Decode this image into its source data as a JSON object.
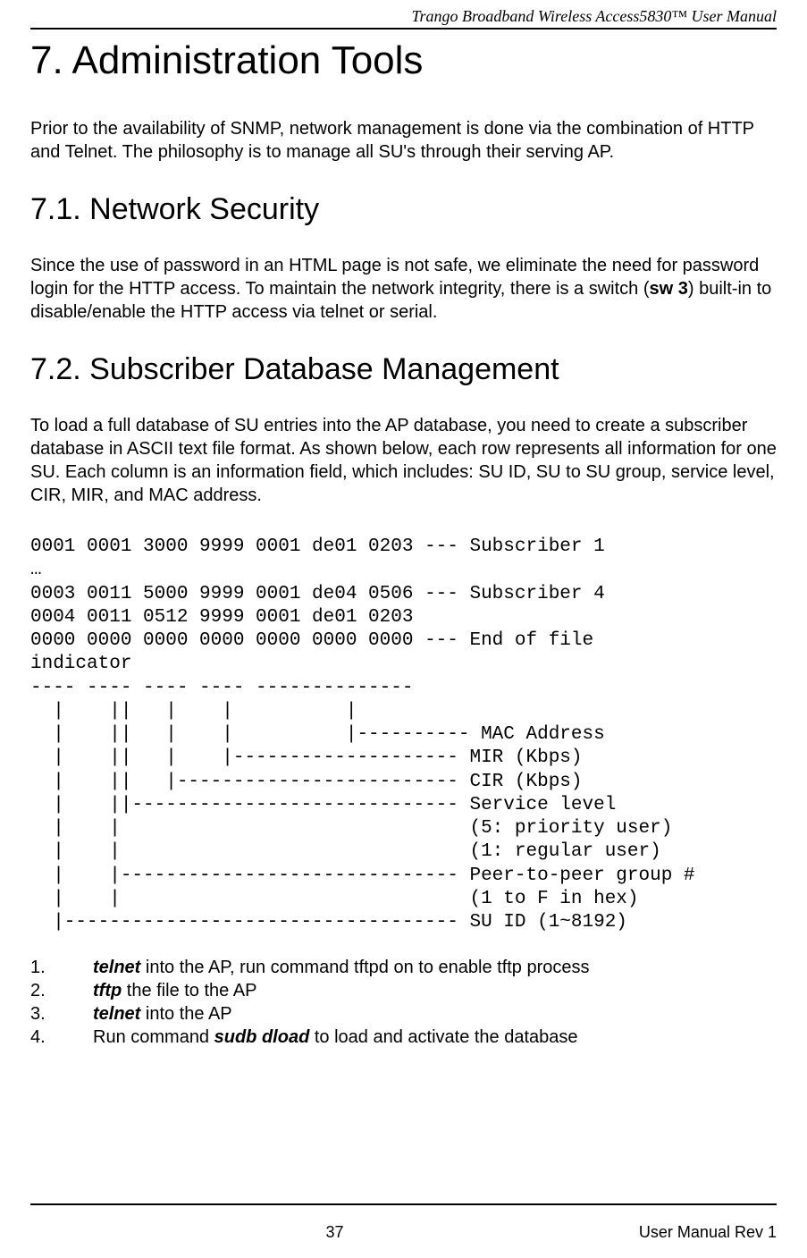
{
  "header": {
    "title": "Trango Broadband Wireless Access5830™  User Manual"
  },
  "h1": "7.  Administration Tools",
  "p1": "Prior to the availability of SNMP, network management is done via the combination of HTTP and Telnet.  The philosophy is to manage all SU's through their serving AP.",
  "h2_1": "7.1.  Network Security",
  "p2_pre": "Since the use of password in an HTML page is not safe, we eliminate the need for password login for the HTTP access.  To maintain the network integrity, there is a switch (",
  "p2_bold": "sw 3",
  "p2_post": ") built-in to disable/enable the HTTP access via telnet or serial.",
  "h2_2": "7.2.  Subscriber Database Management",
  "p3": "To load a full database of SU entries into the AP database, you need to create a subscriber database in ASCII text file format.  As shown below, each row represents all information for one SU.  Each column is an information field, which includes: SU ID, SU to SU group, service level, CIR, MIR, and MAC address.",
  "preblock": "0001 0001 3000 9999 0001 de01 0203 --- Subscriber 1\n…\n0003 0011 5000 9999 0001 de04 0506 --- Subscriber 4\n0004 0011 0512 9999 0001 de01 0203\n0000 0000 0000 0000 0000 0000 0000 --- End of file\nindicator\n---- ---- ---- ---- --------------\n  |    ||   |    |          |\n  |    ||   |    |          |---------- MAC Address\n  |    ||   |    |-------------------- MIR (Kbps)\n  |    ||   |------------------------- CIR (Kbps)\n  |    ||----------------------------- Service level\n  |    |                               (5: priority user)\n  |    |                               (1: regular user)\n  |    |------------------------------ Peer-to-peer group #\n  |    |                               (1 to F in hex)\n  |----------------------------------- SU ID (1~8192)",
  "steps": [
    {
      "num": "1.",
      "pre": "",
      "bold": "telnet",
      "post": " into the AP, run command tftpd on to enable tftp process"
    },
    {
      "num": "2.",
      "pre": "",
      "bold": "tftp",
      "post": " the file to the AP"
    },
    {
      "num": "3.",
      "pre": "",
      "bold": "telnet",
      "post": " into the AP"
    },
    {
      "num": "4.",
      "pre": "Run command ",
      "bold": "sudb dload",
      "post": " to load and activate the database"
    }
  ],
  "footer": {
    "page": "37",
    "rev": "User Manual Rev 1"
  }
}
